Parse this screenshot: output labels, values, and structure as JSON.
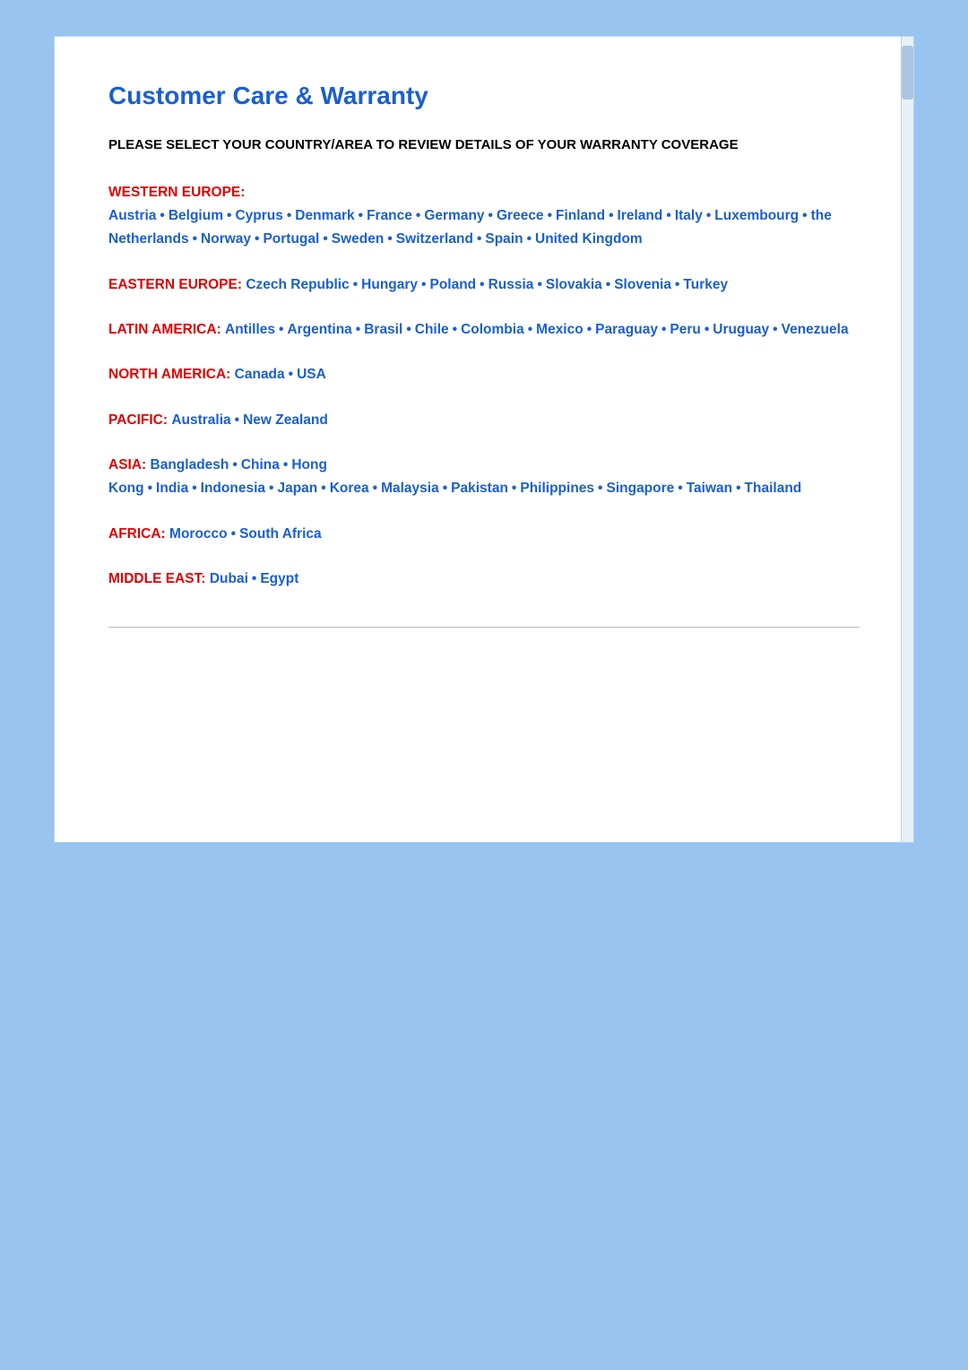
{
  "page": {
    "title": "Customer Care & Warranty",
    "instruction": "PLEASE SELECT YOUR COUNTRY/AREA TO REVIEW DETAILS OF YOUR WARRANTY COVERAGE",
    "regions": [
      {
        "id": "western-europe",
        "label": "WESTERN EUROPE:",
        "countries": [
          "Austria",
          "Belgium",
          "Cyprus",
          "Denmark",
          "France",
          "Germany",
          "Greece",
          "Finland",
          "Ireland",
          "Italy",
          "Luxembourg",
          "the Netherlands",
          "Norway",
          "Portugal",
          "Sweden",
          "Switzerland",
          "Spain",
          "United Kingdom"
        ]
      },
      {
        "id": "eastern-europe",
        "label": "EASTERN EUROPE:",
        "countries": [
          "Czech Republic",
          "Hungary",
          "Poland",
          "Russia",
          "Slovakia",
          "Slovenia",
          "Turkey"
        ]
      },
      {
        "id": "latin-america",
        "label": "LATIN AMERICA:",
        "countries": [
          "Antilles",
          "Argentina",
          "Brasil",
          "Chile",
          "Colombia",
          "Mexico",
          "Paraguay",
          "Peru",
          "Uruguay",
          "Venezuela"
        ]
      },
      {
        "id": "north-america",
        "label": "NORTH AMERICA:",
        "countries": [
          "Canada",
          "USA"
        ]
      },
      {
        "id": "pacific",
        "label": "PACIFIC:",
        "countries": [
          "Australia",
          "New Zealand"
        ]
      },
      {
        "id": "asia",
        "label": "ASIA:",
        "countries": [
          "Bangladesh",
          "China",
          "Hong Kong",
          "India",
          "Indonesia",
          "Japan",
          "Korea",
          "Malaysia",
          "Pakistan",
          "Philippines",
          "Singapore",
          "Taiwan",
          "Thailand"
        ]
      },
      {
        "id": "africa",
        "label": "AFRICA:",
        "countries": [
          "Morocco",
          "South Africa"
        ]
      },
      {
        "id": "middle-east",
        "label": "MIDDLE EAST:",
        "countries": [
          "Dubai",
          "Egypt"
        ]
      }
    ]
  }
}
